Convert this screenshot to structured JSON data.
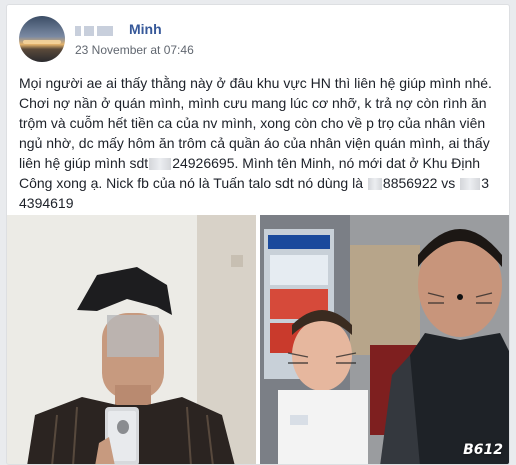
{
  "post": {
    "author": {
      "name_visible": "Minh",
      "avatar": "sunset-avatar"
    },
    "timestamp": "23 November at 07:46",
    "text_segments": [
      "Mọi người ae ai thấy thằng này ở đâu khu vực HN thì liên hệ giúp mình nhé. Chơi nợ nần ở quán mình, mình cưu mang lúc cơ nhỡ, k trả nợ còn rình ăn trộm và cuỗm hết tiền ca của nv mình, xong còn cho về p trọ của nhân viên ngủ nhờ, dc mấy hôm ăn trôm cả quần áo của nhân viện quán mình, ai thấy liên hệ giúp mình sdt",
      "24926695. Mình tên Minh, nó mới dat ở Khu Định Công xong ạ. Nick fb của nó là Tuấn talo sdt nó dùng là",
      "8856922 vs",
      "3 4394619"
    ],
    "photo_watermark": "B612"
  }
}
